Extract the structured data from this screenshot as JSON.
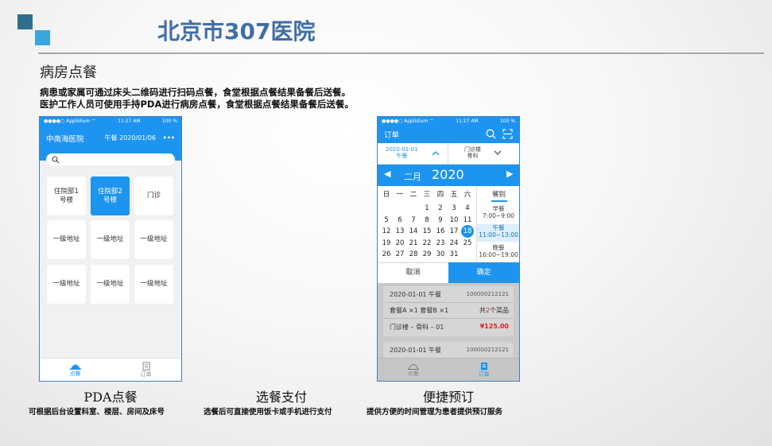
{
  "header": {
    "title": "北京市307医院"
  },
  "section_title": "病房点餐",
  "description": [
    "病患或家属可通过床头二维码进行扫码点餐，食堂根据点餐结果备餐后送餐。",
    "医护工作人员可使用手持PDA进行病房点餐，食堂根据点餐结果备餐后送餐。"
  ],
  "statusbar": {
    "carrier": "●●●●○ Applidium ⌔",
    "time": "11:27 AM",
    "battery": "100 %"
  },
  "phone1": {
    "hospital": "中南海医院",
    "meal_date": "午餐 2020/01/06",
    "more": "•••",
    "buildings": [
      "住院部1\n号楼",
      "住院部2\n号楼",
      "门诊"
    ],
    "address_label": "一级地址",
    "tabs": [
      "点餐",
      "订单"
    ]
  },
  "phone3": {
    "title": "订单",
    "date_filter": "2020-01-01\n午餐",
    "dept_filter": "门诊楼\n骨科",
    "month": "二月",
    "year": "2020",
    "weekdays": [
      "日",
      "一",
      "二",
      "三",
      "四",
      "五",
      "六"
    ],
    "days": [
      [
        "",
        "",
        "",
        "1",
        "2",
        "3",
        "4"
      ],
      [
        "5",
        "6",
        "7",
        "8",
        "9",
        "10",
        "11"
      ],
      [
        "12",
        "13",
        "14",
        "15",
        "16",
        "17",
        "18"
      ],
      [
        "19",
        "20",
        "21",
        "22",
        "23",
        "24",
        "25"
      ],
      [
        "26",
        "27",
        "28",
        "29",
        "30",
        "31",
        ""
      ]
    ],
    "selected_day": "18",
    "meal_header": "餐别",
    "meals": [
      {
        "name": "早餐",
        "time": "7:00~9:00"
      },
      {
        "name": "午餐",
        "time": "11:00~13:00"
      },
      {
        "name": "晚餐",
        "time": "16:00~19:00"
      }
    ],
    "cancel": "取消",
    "confirm": "确定",
    "orders": [
      {
        "date": "2020-01-01 午餐",
        "no": "100000212121",
        "items": "套餐A ×1  套餐B ×1",
        "count_prefix": "共",
        "count": "2",
        "count_suffix": "个菜品",
        "place": "门诊楼 – 骨科 – 01",
        "price": "¥125.00"
      },
      {
        "date": "2020-01-01 午餐",
        "no": "100000212121"
      }
    ],
    "tabs": [
      "点餐",
      "订单"
    ]
  },
  "captions": [
    {
      "title": "PDA点餐",
      "sub": "可根据后台设置科室、楼层、房间及床号"
    },
    {
      "title": "选餐支付",
      "sub": "选餐后可直接使用饭卡或手机进行支付"
    },
    {
      "title": "便捷预订",
      "sub": "提供方便的时间管理为患者提供预订服务"
    }
  ],
  "colors": {
    "brand_blue": "#1d94f0",
    "title_blue": "#3f6ea8",
    "price_red": "#e02020",
    "logo_dark": "#2f6f8c",
    "logo_light": "#3aa6e0"
  }
}
